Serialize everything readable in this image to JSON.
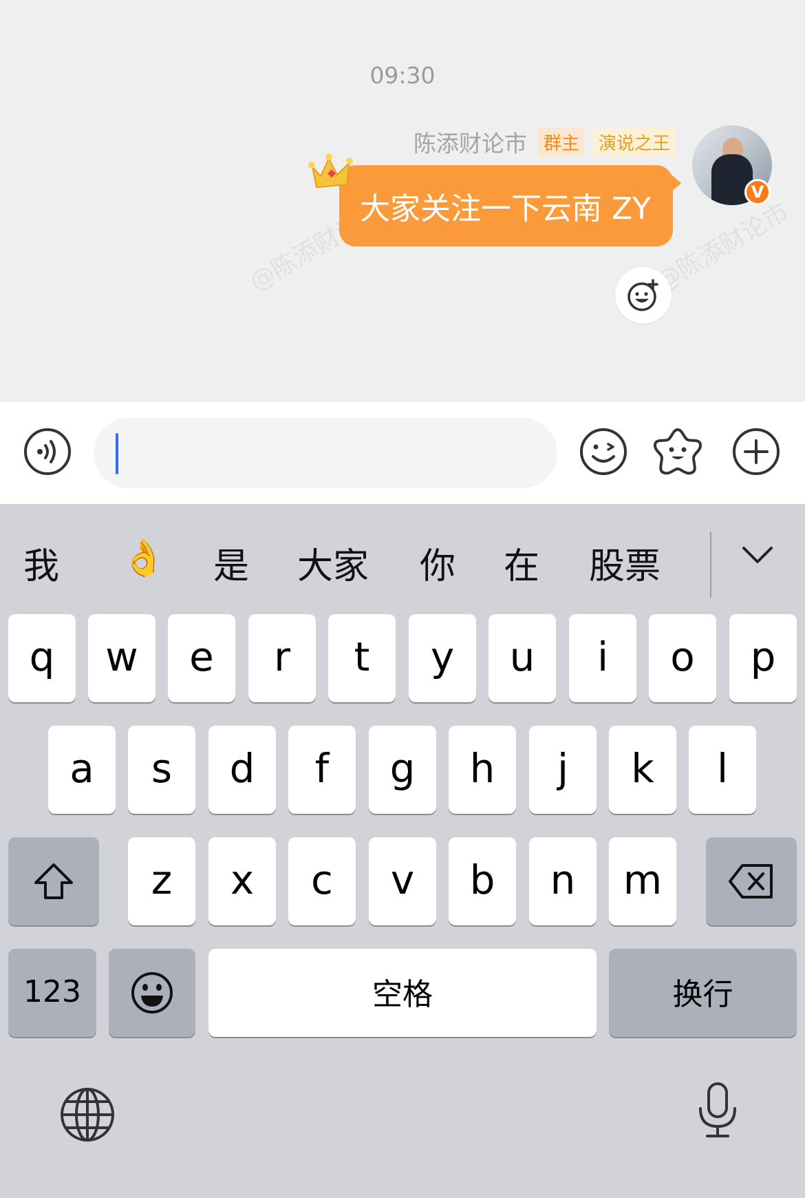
{
  "chat": {
    "timestamp": "09:30",
    "watermark": "@陈添财论市",
    "message": {
      "sender_name": "陈添财论市",
      "badges": [
        "群主",
        "演说之王"
      ],
      "text": "大家关注一下云南 ZY",
      "avatar_icon": "avatar-photo",
      "verified_icon": "V"
    },
    "react_icon": "add-reaction-icon"
  },
  "input_bar": {
    "text_value": "",
    "icons": [
      "voice-icon",
      "emoji-icon",
      "sticker-icon",
      "plus-icon"
    ]
  },
  "keyboard": {
    "candidates": [
      "我",
      "👌",
      "是",
      "大家",
      "你",
      "在",
      "股票"
    ],
    "row1": [
      "q",
      "w",
      "e",
      "r",
      "t",
      "y",
      "u",
      "i",
      "o",
      "p"
    ],
    "row2": [
      "a",
      "s",
      "d",
      "f",
      "g",
      "h",
      "j",
      "k",
      "l"
    ],
    "row3": [
      "z",
      "x",
      "c",
      "v",
      "b",
      "n",
      "m"
    ],
    "numbers_key": "123",
    "space_key": "空格",
    "return_key": "换行",
    "icons": [
      "shift-icon",
      "backspace-icon",
      "emoji-key-icon",
      "globe-icon",
      "mic-icon",
      "collapse-icon"
    ]
  },
  "colors": {
    "bubble": "#fb9a3a",
    "accent": "#2f6df6",
    "keyboard_bg": "#d1d3d9"
  }
}
